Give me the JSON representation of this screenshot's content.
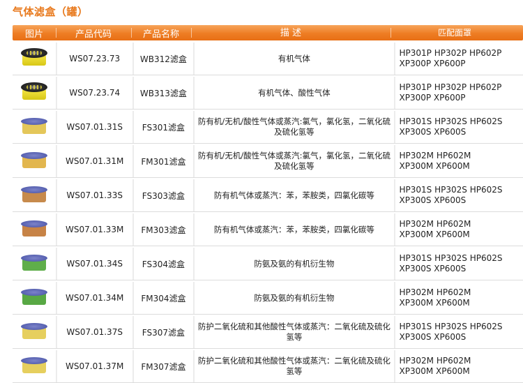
{
  "page_title": "气体滤盒（罐）",
  "table": {
    "headers": [
      "图片",
      "产品代码",
      "产品名称",
      "描  述",
      "匹配面罩"
    ],
    "rows": [
      {
        "image": "cartridge-yellow-black-icon",
        "code": "WS07.23.73",
        "name": "WB312滤盒",
        "desc": "有机气体",
        "fit": "HP301P HP302P HP602P\nXP300P  XP600P",
        "color": "#e8d61c"
      },
      {
        "image": "cartridge-yellow-black-icon",
        "code": "WS07.23.74",
        "name": "WB313滤盒",
        "desc": "有机气体、酸性气体",
        "fit": "HP301P HP302P HP602P\nXP300P  XP600P",
        "color": "#e8d61c"
      },
      {
        "image": "cartridge-blue-yellow-icon",
        "code": "WS07.01.31S",
        "name": "FS301滤盒",
        "desc": "防有机/无机/酸性气体或蒸汽:氯气，氯化氢，二氧化硫及硫化氢等",
        "fit": "HP301S HP302S HP602S\nXP300S  XP600S",
        "color": "#e4c75a"
      },
      {
        "image": "cartridge-blue-yellow-icon",
        "code": "WS07.01.31M",
        "name": "FM301滤盒",
        "desc": "防有机/无机/酸性气体或蒸汽:氯气，氯化氢，二氧化硫及硫化氢等",
        "fit": "HP302M  HP602M\nXP300M  XP600M",
        "color": "#e2b64e"
      },
      {
        "image": "cartridge-blue-brown-icon",
        "code": "WS07.01.33S",
        "name": "FS303滤盒",
        "desc": "防有机气体或蒸汽：苯，苯胺类，四氯化碳等",
        "fit": "HP301S HP302S HP602S\nXP300S  XP600S",
        "color": "#c78a4c"
      },
      {
        "image": "cartridge-blue-brown-icon",
        "code": "WS07.01.33M",
        "name": "FM303滤盒",
        "desc": "防有机气体或蒸汽：苯，苯胺类，四氯化碳等",
        "fit": "HP302M  HP602M\nXP300M  XP600M",
        "color": "#c78346"
      },
      {
        "image": "cartridge-blue-green-icon",
        "code": "WS07.01.34S",
        "name": "FS304滤盒",
        "desc": "防氨及氨的有机衍生物",
        "fit": "HP301S HP302S HP602S\nXP300S  XP600S",
        "color": "#5fae4a"
      },
      {
        "image": "cartridge-blue-green-icon",
        "code": "WS07.01.34M",
        "name": "FM304滤盒",
        "desc": "防氨及氨的有机衍生物",
        "fit": "HP302M  HP602M\nXP300M  XP600M",
        "color": "#58a844"
      },
      {
        "image": "cartridge-blue-yellow-icon",
        "code": "WS07.01.37S",
        "name": "FS307滤盒",
        "desc": "防护二氧化硫和其他酸性气体或蒸汽：二氧化硫及硫化氢等",
        "fit": "HP301S HP302S HP602S\nXP300S  XP600S",
        "color": "#e6cf5e"
      },
      {
        "image": "cartridge-blue-yellow-icon",
        "code": "WS07.01.37M",
        "name": "FM307滤盒",
        "desc": "防护二氧化硫和其他酸性气体或蒸汽：二氧化硫及硫化氢等",
        "fit": "HP302M  HP602M\nXP300M  XP600M",
        "color": "#e6cf5e"
      }
    ]
  },
  "colors": {
    "header": "#ee7d24",
    "title": "#e8791c"
  }
}
